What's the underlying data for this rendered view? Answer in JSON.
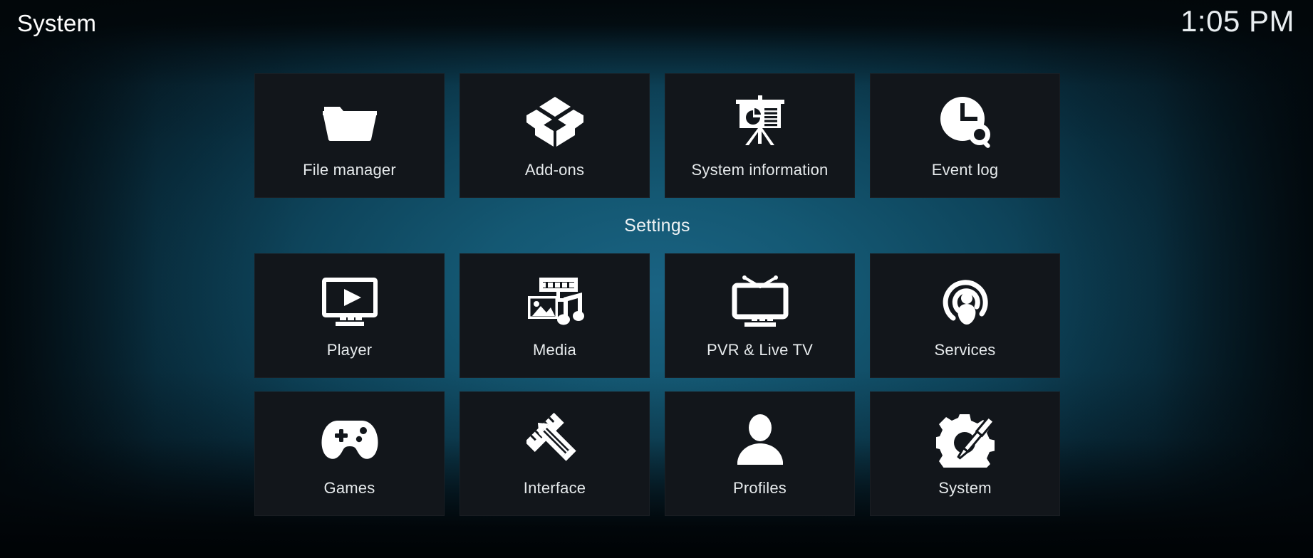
{
  "window": {
    "title": "System",
    "clock": "1:05 PM",
    "background_color": "#0e455c",
    "tile_color": "#12161b",
    "text_color": "#e6eaec"
  },
  "groups": [
    {
      "heading": null,
      "tiles": [
        {
          "label": "File manager",
          "icon": "folder-icon"
        },
        {
          "label": "Add-ons",
          "icon": "open-box-icon"
        },
        {
          "label": "System information",
          "icon": "presentation-chart-icon"
        },
        {
          "label": "Event log",
          "icon": "clock-search-icon"
        }
      ]
    },
    {
      "heading": "Settings",
      "tiles": [
        {
          "label": "Player",
          "icon": "monitor-play-icon"
        },
        {
          "label": "Media",
          "icon": "film-photo-music-icon"
        },
        {
          "label": "PVR & Live TV",
          "icon": "tv-antenna-icon"
        },
        {
          "label": "Services",
          "icon": "podcast-broadcast-icon"
        },
        {
          "label": "Games",
          "icon": "gamepad-icon"
        },
        {
          "label": "Interface",
          "icon": "pencil-ruler-icon"
        },
        {
          "label": "Profiles",
          "icon": "person-icon"
        },
        {
          "label": "System",
          "icon": "gear-tools-icon"
        }
      ]
    }
  ]
}
